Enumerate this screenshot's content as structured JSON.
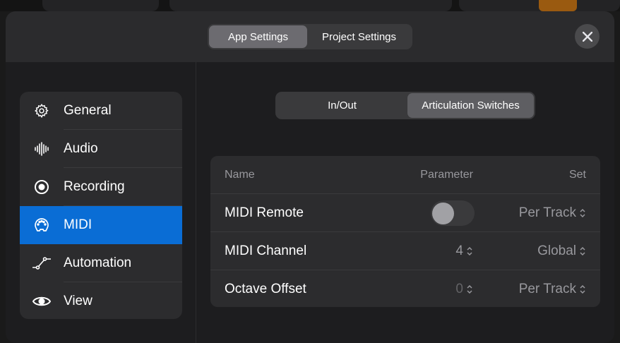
{
  "header": {
    "tabs": [
      {
        "label": "App Settings",
        "selected": true
      },
      {
        "label": "Project Settings",
        "selected": false
      }
    ],
    "close_icon": "close-icon"
  },
  "sidebar": {
    "items": [
      {
        "label": "General",
        "icon": "gear-icon"
      },
      {
        "label": "Audio",
        "icon": "waveform-icon"
      },
      {
        "label": "Recording",
        "icon": "record-icon"
      },
      {
        "label": "MIDI",
        "icon": "midi-port-icon",
        "selected": true
      },
      {
        "label": "Automation",
        "icon": "automation-curve-icon"
      },
      {
        "label": "View",
        "icon": "eye-icon"
      }
    ]
  },
  "subtabs": [
    {
      "label": "In/Out",
      "selected": false
    },
    {
      "label": "Articulation Switches",
      "selected": true
    }
  ],
  "table": {
    "headers": {
      "name": "Name",
      "parameter": "Parameter",
      "set": "Set"
    },
    "rows": [
      {
        "name": "MIDI Remote",
        "parameter": "off",
        "set": "Per Track"
      },
      {
        "name": "MIDI Channel",
        "parameter": "4",
        "set": "Global"
      },
      {
        "name": "Octave Offset",
        "parameter": "0",
        "set": "Per Track"
      }
    ]
  },
  "colors": {
    "accent": "#0a6dd5",
    "panel": "#2c2c2e"
  }
}
